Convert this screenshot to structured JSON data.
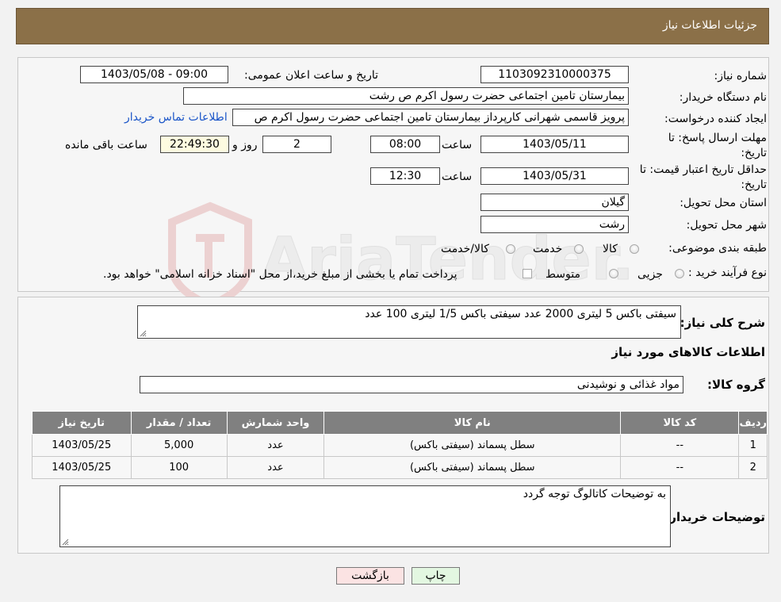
{
  "header": {
    "title": "جزئیات اطلاعات نیاز"
  },
  "form": {
    "need_number_label": "شماره نیاز:",
    "need_number": "1103092310000375",
    "announce_label": "تاریخ و ساعت اعلان عمومی:",
    "announce_value": "1403/05/08 - 09:00",
    "buyer_label": "نام دستگاه خریدار:",
    "buyer_value": "بیمارستان  تامین اجتماعی حضرت رسول اکرم ص رشت",
    "creator_label": "ایجاد کننده درخواست:",
    "creator_value": "پرویز قاسمی شهرانی کارپرداز بیمارستان  تامین اجتماعی حضرت رسول اکرم ص",
    "contact_link": "اطلاعات تماس خریدار",
    "deadline_label_1": "مهلت ارسال پاسخ: تا",
    "deadline_label_2": "تاریخ:",
    "deadline_date": "1403/05/11",
    "time_label": "ساعت",
    "deadline_time": "08:00",
    "days_value": "2",
    "days_label": "روز و",
    "remaining_time": "22:49:30",
    "remaining_label": "ساعت باقی مانده",
    "validity_label_1": "حداقل تاریخ اعتبار قیمت: تا",
    "validity_label_2": "تاریخ:",
    "validity_date": "1403/05/31",
    "validity_time": "12:30",
    "province_label": "استان محل تحویل:",
    "province_value": "گیلان",
    "city_label": "شهر محل تحویل:",
    "city_value": "رشت",
    "category_label": "طبقه بندی موضوعی:",
    "category_options": [
      "کالا",
      "خدمت",
      "کالا/خدمت"
    ],
    "purchase_type_label": "نوع فرآیند خرید :",
    "purchase_options": [
      "جزیی",
      "متوسط"
    ],
    "payment_note": "پرداخت تمام یا بخشی از مبلغ خرید،از محل \"اسناد خزانه اسلامی\" خواهد بود."
  },
  "details": {
    "summary_label": "شرح کلی نیاز:",
    "summary_value": "سیفتی باکس 5 لیتری 2000 عدد سیفتی باکس 1/5 لیتری 100 عدد",
    "goods_info_title": "اطلاعات کالاهای مورد نیاز",
    "goods_group_label": "گروه کالا:",
    "goods_group_value": "مواد غذائی و نوشیدنی",
    "table": {
      "headers": [
        "ردیف",
        "کد کالا",
        "نام کالا",
        "واحد شمارش",
        "تعداد / مقدار",
        "تاریخ نیاز"
      ],
      "rows": [
        [
          "1",
          "--",
          "سطل پسماند (سیفتی باکس)",
          "عدد",
          "5,000",
          "1403/05/25"
        ],
        [
          "2",
          "--",
          "سطل پسماند (سیفتی باکس)",
          "عدد",
          "100",
          "1403/05/25"
        ]
      ]
    },
    "buyer_notes_label": "توضیحات خریدار:",
    "buyer_notes_value": "به توضیحات کاتالوگ توجه گردد"
  },
  "buttons": {
    "print": "چاپ",
    "back": "بازگشت"
  },
  "watermark": "AriaTender.neT",
  "colors": {
    "header_bg": "#8b7048",
    "table_header_bg": "#808080",
    "link": "#1a55c8",
    "back_button_bg": "#fbe3e3",
    "print_button_bg": "#e3f7e1"
  }
}
